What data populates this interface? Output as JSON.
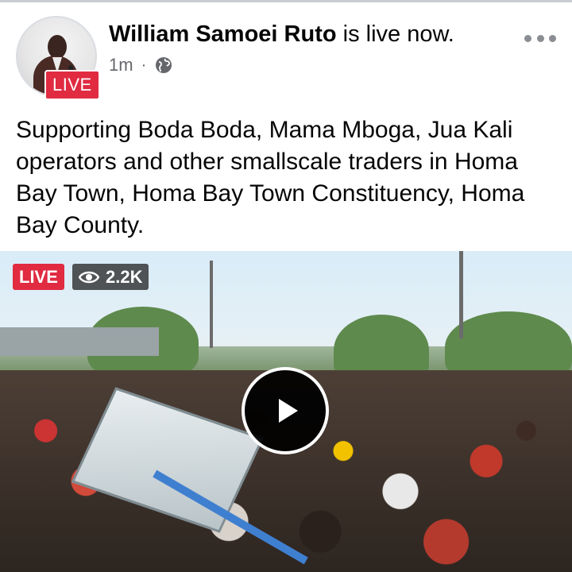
{
  "post": {
    "author_name": "William Samoei Ruto",
    "status_suffix": " is live now.",
    "live_badge": "LIVE",
    "time_ago": "1m",
    "separator": "·",
    "audience_icon": "globe-icon",
    "menu_icon": "more-options-icon",
    "text": "Supporting Boda Boda, Mama Mboga, Jua Kali operators and other smallscale traders in Homa Bay Town, Homa Bay Town Constituency, Homa Bay County."
  },
  "video": {
    "live_label": "LIVE",
    "viewer_icon": "eye-icon",
    "viewer_count": "2.2K",
    "play_icon": "play-icon"
  },
  "colors": {
    "live_red": "#e02b41",
    "text_primary": "#050505",
    "text_secondary": "#65676b"
  }
}
